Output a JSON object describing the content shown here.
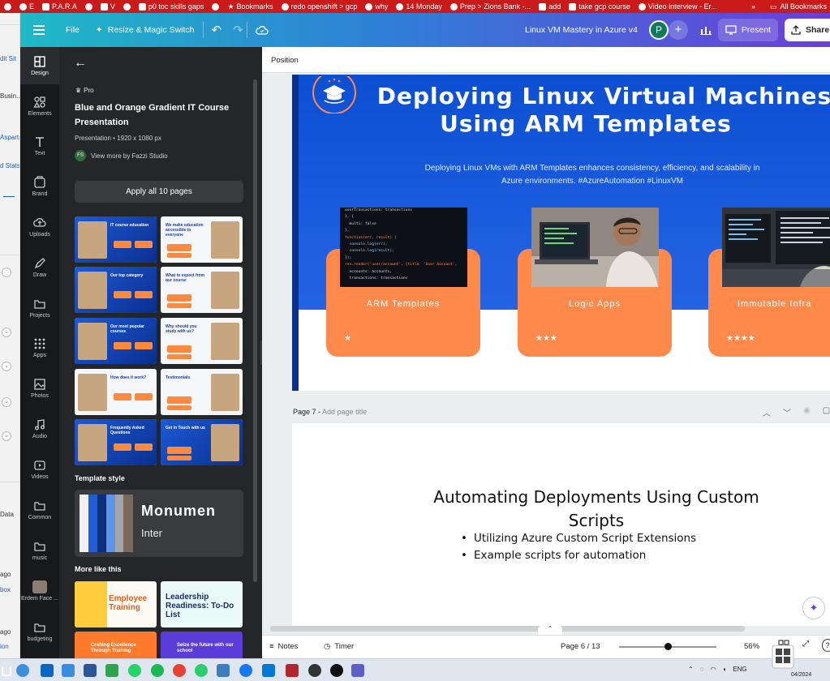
{
  "browser": {
    "bookmarks": [
      {
        "label": "",
        "icon": "wordpress-icon"
      },
      {
        "label": "E",
        "icon": "wordpress-icon"
      },
      {
        "label": "P.A.R.A",
        "icon": "folder-icon"
      },
      {
        "label": "",
        "icon": "cloud-icon"
      },
      {
        "label": "V",
        "icon": "tag-icon"
      },
      {
        "label": "",
        "icon": "link-icon"
      },
      {
        "label": "p0 toc skills gaps",
        "icon": "tag-icon"
      },
      {
        "label": "",
        "icon": "circle-icon"
      },
      {
        "label": "Bookmarks",
        "icon": "star-icon"
      },
      {
        "label": "redo openshift > gcp",
        "icon": "wordpress-icon"
      },
      {
        "label": "why",
        "icon": "wordpress-icon"
      },
      {
        "label": "14 Monday",
        "icon": "gmail-icon"
      },
      {
        "label": "Prep > Zions Bank -...",
        "icon": "gmail-icon"
      },
      {
        "label": "add",
        "icon": "sheets-icon"
      },
      {
        "label": "take gcp course",
        "icon": "linkedin-icon"
      },
      {
        "label": "Video interview - Er...",
        "icon": "gmail-icon"
      }
    ],
    "overflow": "»",
    "all_bookmarks": "All Bookmarks"
  },
  "ghost_strip": {
    "texts": [
      "dit Sit",
      "Busin...",
      "Asparts",
      "d Stats",
      "Data",
      "ago",
      "box",
      "ago",
      "ion"
    ]
  },
  "topbar": {
    "file_label": "File",
    "resize_label": "Resize & Magic Switch",
    "doc_title": "Linux VM Mastery in Azure v4",
    "avatar_letter": "P",
    "present_label": "Present",
    "share_label": "Share",
    "accent_gradient": [
      "#1fb9c6",
      "#2f7fd6",
      "#6b3fd9"
    ]
  },
  "rail": {
    "items": [
      {
        "label": "Design",
        "icon": "design-icon"
      },
      {
        "label": "Elements",
        "icon": "elements-icon"
      },
      {
        "label": "Text",
        "icon": "text-icon"
      },
      {
        "label": "Brand",
        "icon": "brand-icon"
      },
      {
        "label": "Uploads",
        "icon": "upload-icon"
      },
      {
        "label": "Draw",
        "icon": "draw-icon"
      },
      {
        "label": "Projects",
        "icon": "folder-icon"
      },
      {
        "label": "Apps",
        "icon": "apps-icon"
      },
      {
        "label": "Photos",
        "icon": "photo-icon"
      },
      {
        "label": "Audio",
        "icon": "audio-icon"
      },
      {
        "label": "Videos",
        "icon": "video-icon"
      },
      {
        "label": "Common",
        "icon": "folder-icon"
      },
      {
        "label": "music",
        "icon": "folder-icon"
      },
      {
        "label": "Erdem Face ...",
        "icon": "thumbnail-icon"
      },
      {
        "label": "budgeting",
        "icon": "folder-icon"
      }
    ]
  },
  "panel": {
    "pro_label": "Pro",
    "template_title": "Blue and Orange Gradient IT Course Presentation",
    "template_meta": "Presentation • 1920 x 1080 px",
    "author_initials": "FS",
    "author_label": "View more by Fazzi Studio",
    "apply_label": "Apply all 10 pages",
    "thumbnails": [
      {
        "heading": "IT course education"
      },
      {
        "heading": "We make education accessible to everyone"
      },
      {
        "heading": "Our top category"
      },
      {
        "heading": "What to expect from our course"
      },
      {
        "heading": "Our most popular courses"
      },
      {
        "heading": "Why should you study with us?"
      },
      {
        "heading": "How does it work?"
      },
      {
        "heading": "Testimonials"
      },
      {
        "heading": "Frequently Asked Questions"
      },
      {
        "heading": "Get in Touch with us"
      }
    ],
    "style_label": "Template style",
    "style_colors": [
      "#f1f1f1",
      "#1f5ed6",
      "#0e2f7c",
      "#5e95e9",
      "#a4a6aa",
      "#7a6a5e"
    ],
    "style_font_heading": "Monumen",
    "style_font_body": "Inter",
    "more_label": "More like this",
    "more": [
      {
        "heading": "Employee Training"
      },
      {
        "heading": "Leadership Readiness: To-Do List"
      },
      {
        "heading": "Crafting Excellence Through Training"
      },
      {
        "heading": "Seize the future with our school"
      }
    ]
  },
  "canvas": {
    "position_label": "Position",
    "slide6": {
      "title_line1": "Deploying Linux Virtual Machines",
      "title_line2": "Using ARM Templates",
      "subtitle": "Deploying Linux VMs with ARM Templates enhances consistency, efficiency, and scalability in Azure environments. #AzureAutomation #LinuxVM",
      "cards": [
        {
          "label": "ARM Templates",
          "stars": "★"
        },
        {
          "label": "Logic Apps",
          "stars": "★★★"
        },
        {
          "label": "Immutable Infra",
          "stars": "★★★★"
        }
      ],
      "code_lines": [
        "userTransactions: transactions",
        "}, {",
        "  multi: false",
        "},",
        "function(err, result) {",
        "  console.log(err);",
        "  console.log(result);",
        "});",
        "res.render('user/account', {title: 'User Account',",
        "  accounts: accounts,",
        "  transactions: transactions"
      ]
    },
    "page7": {
      "label": "Page 7 -",
      "placeholder": "Add page title",
      "title": "Automating Deployments Using Custom Scripts",
      "bullets": [
        "Utilizing Azure Custom Script Extensions",
        "Example scripts for automation"
      ]
    }
  },
  "footer": {
    "notes_label": "Notes",
    "timer_label": "Timer",
    "page_indicator": "Page 6 / 13",
    "zoom": "56%",
    "zoom_fraction": 0.5
  },
  "taskbar": {
    "lang": "ENG",
    "date": "04/2024"
  }
}
